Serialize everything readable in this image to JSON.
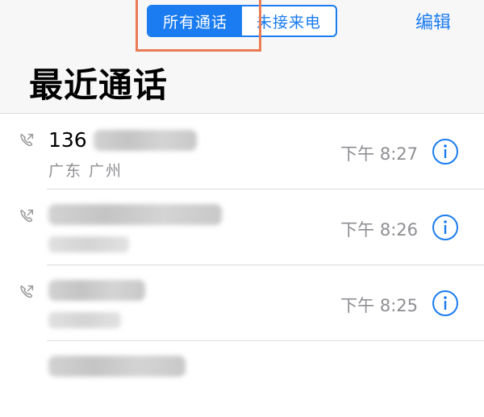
{
  "tabs": [
    {
      "label": "所有通话",
      "active": true
    },
    {
      "label": "未接来电",
      "active": false
    }
  ],
  "edit_label": "编辑",
  "title": "最近通话",
  "calls": [
    {
      "number_prefix": "136",
      "location": "广东 广州",
      "time": "下午 8:27"
    },
    {
      "number_prefix": "",
      "location": "",
      "time": "下午 8:26"
    },
    {
      "number_prefix": "",
      "location": "",
      "time": "下午 8:25"
    }
  ],
  "colors": {
    "accent": "#1a7cf0",
    "highlight": "#ea7b55",
    "secondary_text": "#8e8e93"
  },
  "icons": {
    "call": "outgoing-call-icon",
    "info": "info-icon"
  }
}
